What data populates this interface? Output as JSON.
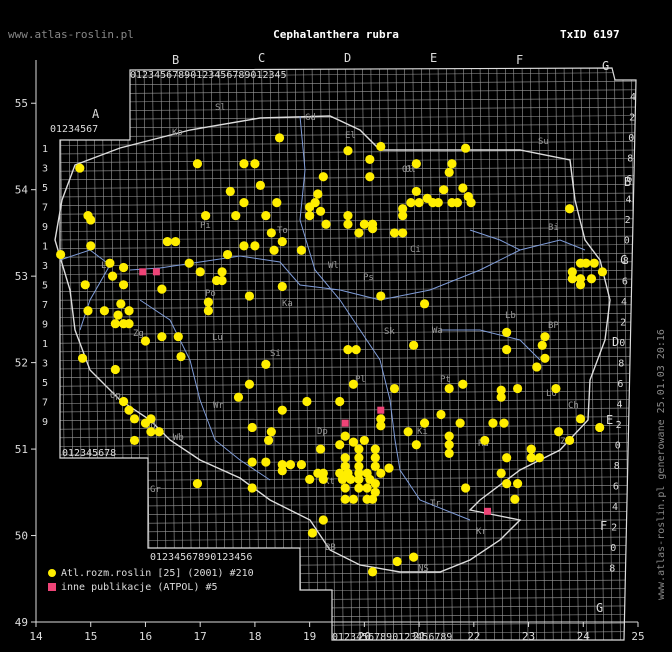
{
  "header": {
    "site": "www.atlas-roslin.pl",
    "title": "Cephalanthera rubra",
    "taxid": "TxID 6197"
  },
  "side_text": "www.atlas-roslin.pl generowane 25.01.03 20:16",
  "legend": {
    "primary": "Atl.rozm.roslin [25] (2001) #210",
    "secondary": "inne publikacje (ATPOL) #5"
  },
  "colors": {
    "background": "#000000",
    "grid": "#9a9a9a",
    "outline": "#dddddd",
    "rivers": "#7f9cd8",
    "primary_point": "#ffee00",
    "secondary_point": "#ee4477"
  },
  "axes": {
    "x_ticks": [
      "14",
      "15",
      "16",
      "17",
      "18",
      "19",
      "20",
      "21",
      "22",
      "23",
      "24",
      "25"
    ],
    "y_ticks": [
      "49",
      "50",
      "51",
      "52",
      "53",
      "54",
      "55"
    ]
  },
  "atpol_labels": {
    "top_letters": [
      "A",
      "B",
      "C",
      "D",
      "E",
      "F",
      "G"
    ],
    "right_letters": [
      "B",
      "C",
      "D",
      "E",
      "F",
      "G"
    ],
    "top_digits": "0123456789",
    "left_digits": [
      "1",
      "3",
      "5",
      "7",
      "9",
      "1",
      "3",
      "5",
      "7",
      "9",
      "1",
      "3",
      "5",
      "7",
      "9"
    ],
    "right_digits": [
      "4",
      "2",
      "0",
      "8",
      "6",
      "4",
      "2",
      "0",
      "8",
      "6",
      "4",
      "2",
      "0",
      "8",
      "6",
      "4",
      "2",
      "0",
      "8",
      "6",
      "4",
      "2",
      "0",
      "8"
    ],
    "bottom_digits": "0123456789"
  },
  "region_abbrs": [
    "Sl",
    "Ko",
    "Gd",
    "El",
    "Su",
    "Bi",
    "Ol",
    "Ci",
    "Pi",
    "To",
    "Wl",
    "Ps",
    "Po",
    "Ka",
    "Ls",
    "Zg",
    "Sk",
    "Wa",
    "BP",
    "Lu",
    "Ch",
    "Lo",
    "Pl",
    "Ki",
    "Wr",
    "Wb",
    "Op",
    "Kt",
    "Dp",
    "Ra",
    "Si",
    "Zm",
    "Tr",
    "Kr",
    "NS",
    "BB",
    "Sd",
    "Lb",
    "Pt",
    "Ol",
    "Gr"
  ],
  "chart_data": {
    "type": "scatter",
    "xlim": [
      14,
      25
    ],
    "ylim": [
      49,
      55.5
    ],
    "series": [
      {
        "name": "Atl.rozm.roslin [25] (2001) #210",
        "points": [
          [
            18.45,
            54.6
          ],
          [
            19.7,
            54.45
          ],
          [
            20.3,
            54.5
          ],
          [
            21.85,
            54.48
          ],
          [
            20.1,
            54.35
          ],
          [
            16.95,
            54.3
          ],
          [
            17.8,
            54.3
          ],
          [
            18.0,
            54.3
          ],
          [
            14.8,
            54.25
          ],
          [
            20.95,
            54.3
          ],
          [
            21.6,
            54.3
          ],
          [
            21.55,
            54.2
          ],
          [
            19.25,
            54.15
          ],
          [
            20.1,
            54.15
          ],
          [
            18.1,
            54.05
          ],
          [
            17.55,
            53.98
          ],
          [
            19.15,
            53.95
          ],
          [
            20.95,
            53.98
          ],
          [
            21.45,
            54.0
          ],
          [
            21.8,
            54.02
          ],
          [
            21.9,
            53.92
          ],
          [
            21.15,
            53.9
          ],
          [
            20.85,
            53.85
          ],
          [
            21.0,
            53.85
          ],
          [
            21.25,
            53.85
          ],
          [
            21.35,
            53.85
          ],
          [
            21.6,
            53.85
          ],
          [
            21.7,
            53.85
          ],
          [
            21.95,
            53.85
          ],
          [
            17.8,
            53.85
          ],
          [
            19.1,
            53.85
          ],
          [
            18.4,
            53.85
          ],
          [
            19.0,
            53.8
          ],
          [
            19.2,
            53.75
          ],
          [
            20.7,
            53.78
          ],
          [
            23.75,
            53.78
          ],
          [
            14.95,
            53.7
          ],
          [
            17.1,
            53.7
          ],
          [
            17.65,
            53.7
          ],
          [
            18.2,
            53.7
          ],
          [
            19.0,
            53.7
          ],
          [
            19.7,
            53.7
          ],
          [
            20.7,
            53.7
          ],
          [
            15.0,
            53.65
          ],
          [
            19.3,
            53.6
          ],
          [
            19.7,
            53.6
          ],
          [
            20.0,
            53.6
          ],
          [
            20.15,
            53.6
          ],
          [
            20.15,
            53.55
          ],
          [
            19.9,
            53.5
          ],
          [
            20.55,
            53.5
          ],
          [
            20.7,
            53.5
          ],
          [
            16.4,
            53.4
          ],
          [
            16.55,
            53.4
          ],
          [
            18.3,
            53.5
          ],
          [
            18.5,
            53.4
          ],
          [
            18.85,
            53.3
          ],
          [
            17.8,
            53.35
          ],
          [
            18.0,
            53.35
          ],
          [
            18.35,
            53.3
          ],
          [
            15.0,
            53.35
          ],
          [
            14.45,
            53.25
          ],
          [
            17.5,
            53.25
          ],
          [
            16.8,
            53.15
          ],
          [
            15.35,
            53.15
          ],
          [
            15.6,
            53.1
          ],
          [
            17.0,
            53.05
          ],
          [
            17.4,
            53.05
          ],
          [
            17.4,
            52.95
          ],
          [
            17.3,
            52.95
          ],
          [
            15.4,
            53.0
          ],
          [
            23.95,
            53.15
          ],
          [
            24.05,
            53.15
          ],
          [
            24.2,
            53.15
          ],
          [
            23.8,
            53.05
          ],
          [
            24.35,
            53.05
          ],
          [
            23.8,
            52.97
          ],
          [
            23.95,
            52.97
          ],
          [
            24.15,
            52.97
          ],
          [
            23.95,
            52.9
          ],
          [
            14.9,
            52.9
          ],
          [
            15.6,
            52.9
          ],
          [
            16.3,
            52.85
          ],
          [
            18.5,
            52.88
          ],
          [
            17.9,
            52.77
          ],
          [
            20.3,
            52.77
          ],
          [
            17.15,
            52.7
          ],
          [
            15.55,
            52.68
          ],
          [
            21.1,
            52.68
          ],
          [
            14.95,
            52.6
          ],
          [
            15.25,
            52.6
          ],
          [
            15.7,
            52.6
          ],
          [
            17.15,
            52.6
          ],
          [
            15.5,
            52.55
          ],
          [
            15.6,
            52.45
          ],
          [
            15.7,
            52.45
          ],
          [
            15.45,
            52.45
          ],
          [
            16.0,
            52.25
          ],
          [
            16.3,
            52.3
          ],
          [
            16.6,
            52.3
          ],
          [
            22.6,
            52.35
          ],
          [
            23.3,
            52.3
          ],
          [
            20.9,
            52.2
          ],
          [
            19.7,
            52.15
          ],
          [
            19.85,
            52.15
          ],
          [
            23.25,
            52.2
          ],
          [
            22.6,
            52.15
          ],
          [
            14.85,
            52.05
          ],
          [
            16.65,
            52.07
          ],
          [
            23.3,
            52.05
          ],
          [
            23.15,
            51.95
          ],
          [
            18.2,
            51.98
          ],
          [
            15.45,
            51.92
          ],
          [
            19.8,
            51.75
          ],
          [
            17.9,
            51.75
          ],
          [
            20.55,
            51.7
          ],
          [
            21.55,
            51.7
          ],
          [
            21.8,
            51.75
          ],
          [
            22.5,
            51.68
          ],
          [
            22.8,
            51.7
          ],
          [
            23.5,
            51.7
          ],
          [
            17.7,
            51.6
          ],
          [
            22.5,
            51.6
          ],
          [
            18.95,
            51.55
          ],
          [
            15.6,
            51.55
          ],
          [
            19.55,
            51.55
          ],
          [
            15.7,
            51.45
          ],
          [
            15.8,
            51.35
          ],
          [
            16.1,
            51.35
          ],
          [
            20.3,
            51.35
          ],
          [
            16.0,
            51.3
          ],
          [
            18.5,
            51.45
          ],
          [
            21.4,
            51.4
          ],
          [
            21.75,
            51.3
          ],
          [
            22.35,
            51.3
          ],
          [
            23.95,
            51.35
          ],
          [
            21.1,
            51.3
          ],
          [
            22.55,
            51.3
          ],
          [
            16.1,
            51.2
          ],
          [
            16.25,
            51.2
          ],
          [
            17.95,
            51.25
          ],
          [
            20.3,
            51.27
          ],
          [
            23.55,
            51.2
          ],
          [
            24.3,
            51.25
          ],
          [
            20.8,
            51.2
          ],
          [
            19.65,
            51.15
          ],
          [
            18.3,
            51.2
          ],
          [
            20.0,
            51.1
          ],
          [
            19.8,
            51.08
          ],
          [
            21.55,
            51.15
          ],
          [
            22.2,
            51.1
          ],
          [
            23.75,
            51.1
          ],
          [
            15.8,
            51.1
          ],
          [
            18.25,
            51.1
          ],
          [
            19.55,
            51.05
          ],
          [
            20.95,
            51.05
          ],
          [
            21.55,
            51.05
          ],
          [
            23.05,
            51.0
          ],
          [
            23.05,
            50.9
          ],
          [
            23.2,
            50.9
          ],
          [
            21.55,
            50.95
          ],
          [
            22.6,
            50.9
          ],
          [
            19.2,
            51.0
          ],
          [
            19.9,
            51.0
          ],
          [
            20.2,
            51.0
          ],
          [
            19.65,
            50.9
          ],
          [
            19.9,
            50.9
          ],
          [
            20.2,
            50.9
          ],
          [
            17.95,
            50.85
          ],
          [
            18.2,
            50.85
          ],
          [
            18.5,
            50.82
          ],
          [
            18.65,
            50.82
          ],
          [
            18.85,
            50.82
          ],
          [
            18.5,
            50.75
          ],
          [
            19.65,
            50.8
          ],
          [
            19.9,
            50.8
          ],
          [
            20.2,
            50.8
          ],
          [
            20.45,
            50.78
          ],
          [
            19.15,
            50.72
          ],
          [
            19.25,
            50.72
          ],
          [
            19.55,
            50.72
          ],
          [
            19.7,
            50.72
          ],
          [
            19.9,
            50.72
          ],
          [
            20.05,
            50.72
          ],
          [
            20.3,
            50.72
          ],
          [
            22.5,
            50.72
          ],
          [
            19.0,
            50.65
          ],
          [
            19.25,
            50.65
          ],
          [
            19.6,
            50.65
          ],
          [
            19.75,
            50.65
          ],
          [
            19.9,
            50.65
          ],
          [
            20.1,
            50.65
          ],
          [
            20.2,
            50.6
          ],
          [
            21.85,
            50.55
          ],
          [
            22.6,
            50.6
          ],
          [
            22.8,
            50.6
          ],
          [
            17.95,
            50.55
          ],
          [
            19.65,
            50.55
          ],
          [
            19.9,
            50.55
          ],
          [
            20.05,
            50.55
          ],
          [
            20.2,
            50.5
          ],
          [
            19.65,
            50.42
          ],
          [
            19.8,
            50.42
          ],
          [
            20.05,
            50.42
          ],
          [
            20.15,
            50.42
          ],
          [
            22.75,
            50.42
          ],
          [
            16.95,
            50.6
          ],
          [
            19.25,
            50.18
          ],
          [
            19.05,
            50.03
          ],
          [
            20.9,
            49.75
          ],
          [
            20.6,
            49.7
          ],
          [
            20.15,
            49.58
          ]
        ]
      },
      {
        "name": "inne publikacje (ATPOL) #5",
        "points": [
          [
            15.95,
            53.05
          ],
          [
            16.2,
            53.05
          ],
          [
            20.3,
            51.45
          ],
          [
            19.65,
            51.3
          ],
          [
            22.25,
            50.28
          ]
        ]
      }
    ]
  }
}
